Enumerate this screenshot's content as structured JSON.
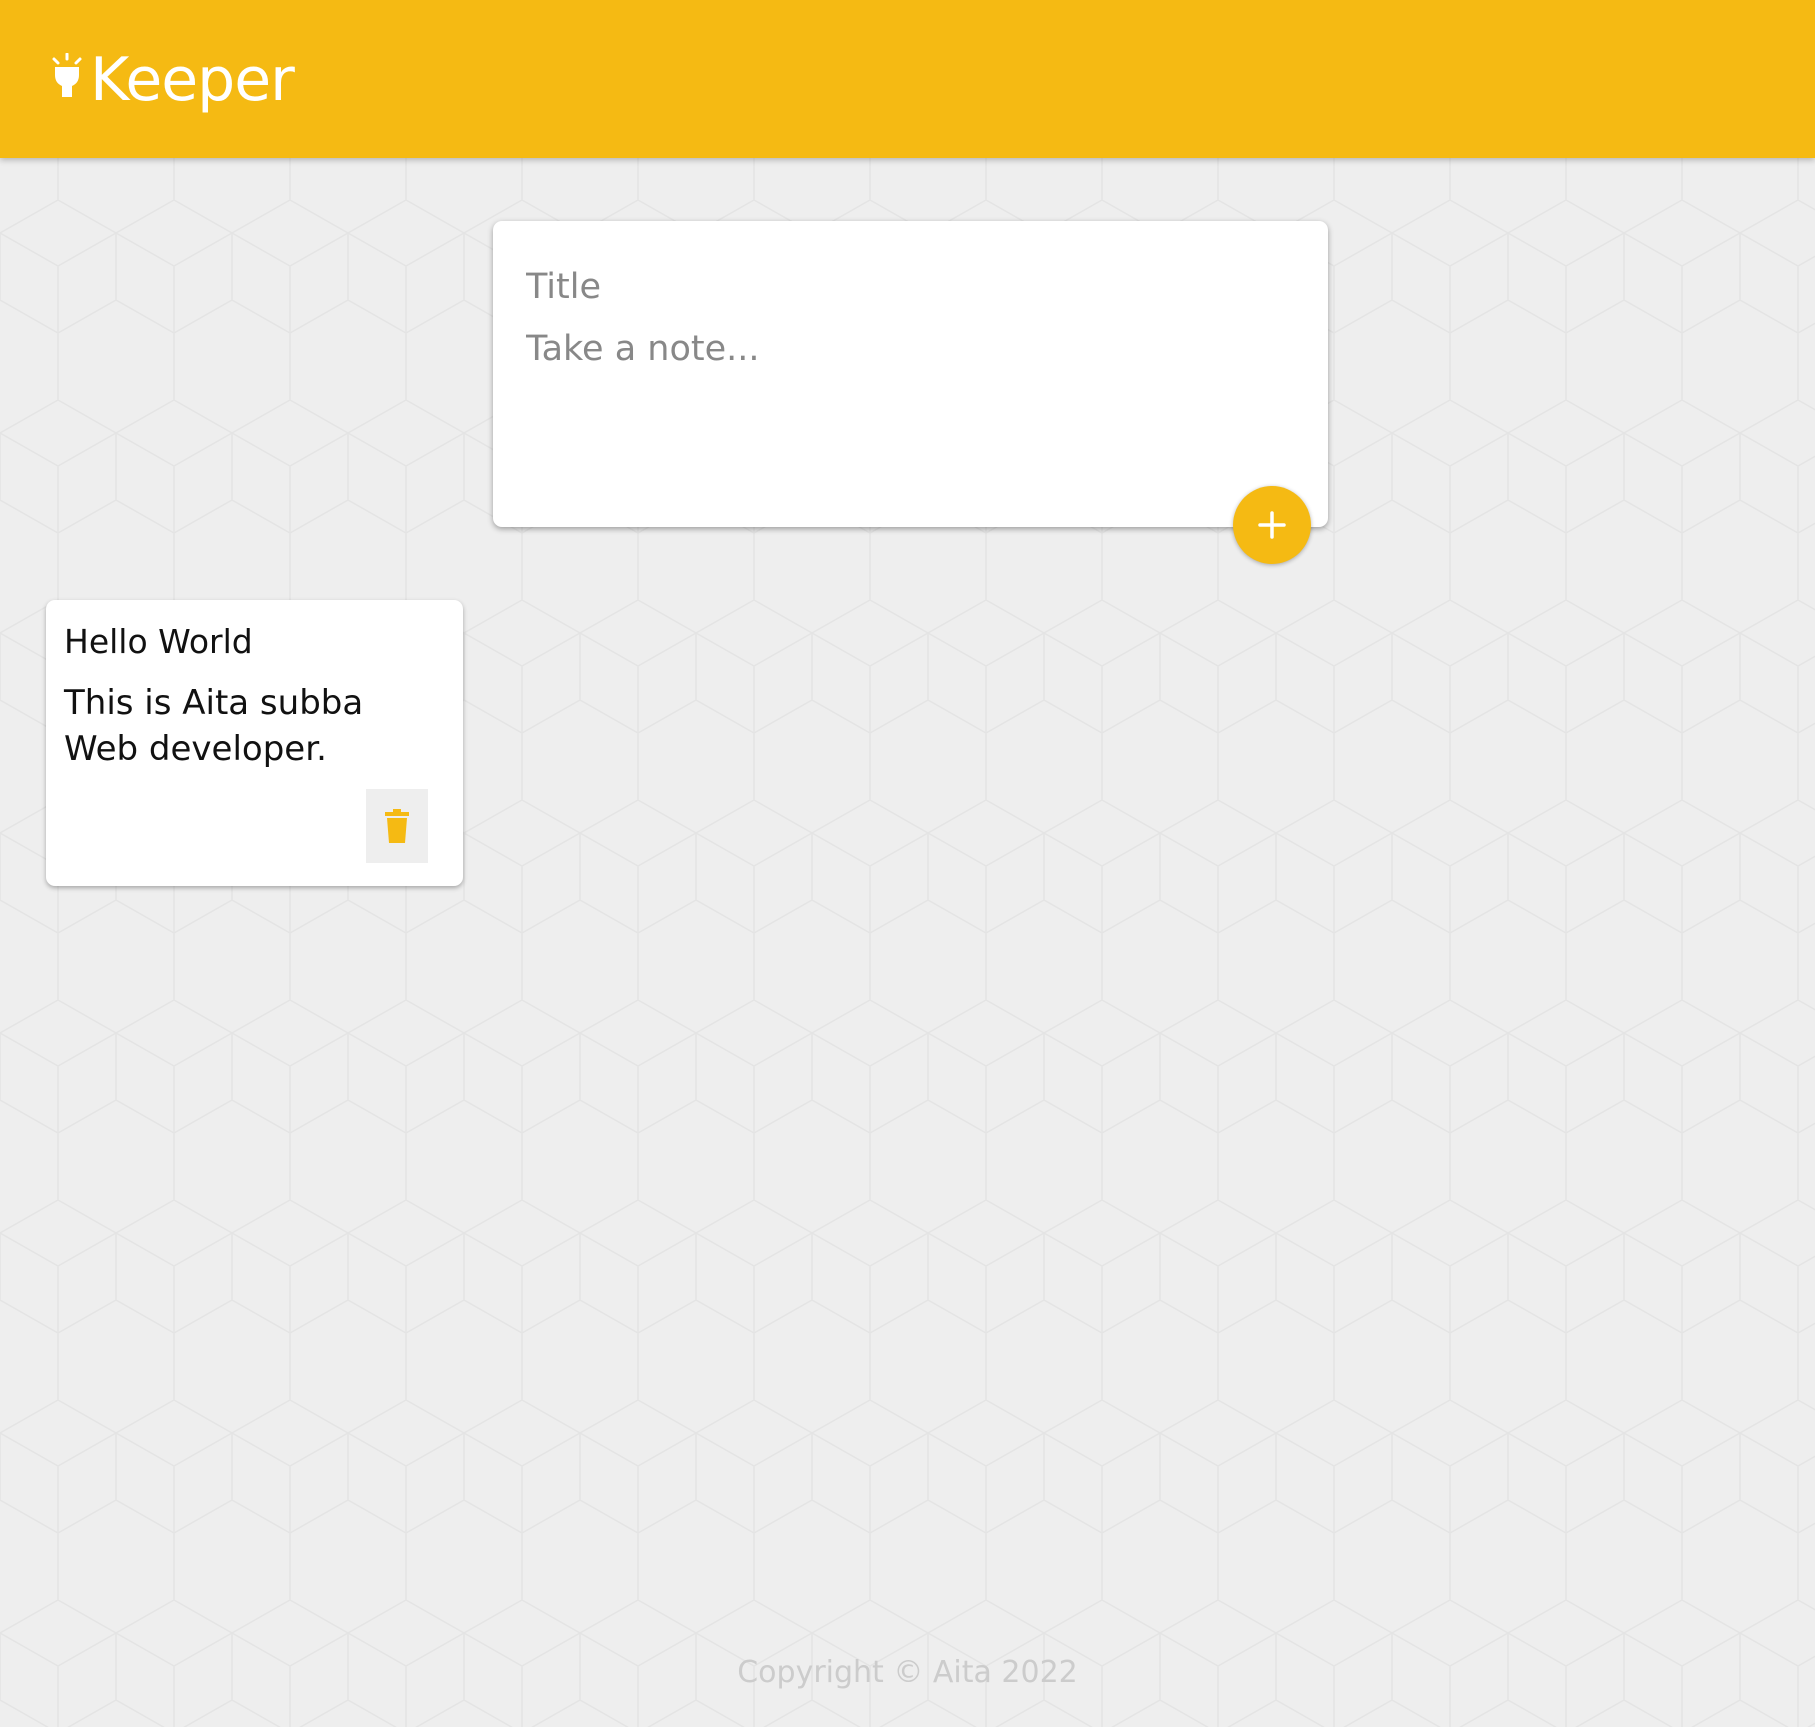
{
  "app": {
    "name": "Keeper",
    "accent_color": "#f5ba13",
    "background_color": "#eeeeee",
    "logo_icon": "lightbulb-icon"
  },
  "create_note": {
    "title_placeholder": "Title",
    "content_placeholder": "Take a note...",
    "add_icon": "plus-icon"
  },
  "notes": [
    {
      "title": "Hello World",
      "content": "This is Aita subba Web developer.",
      "delete_icon": "trash-icon"
    }
  ],
  "footer": {
    "copyright": "Copyright © Aita 2022"
  }
}
